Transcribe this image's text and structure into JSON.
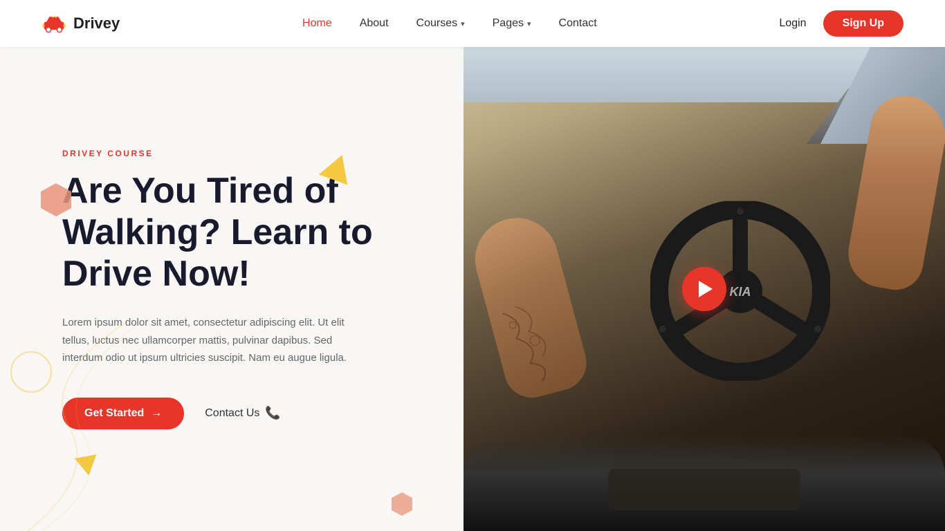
{
  "brand": {
    "logo_text": "Drivey",
    "logo_icon_label": "car-icon"
  },
  "navbar": {
    "links": [
      {
        "id": "home",
        "label": "Home",
        "active": true,
        "has_dropdown": false
      },
      {
        "id": "about",
        "label": "About",
        "active": false,
        "has_dropdown": false
      },
      {
        "id": "courses",
        "label": "Courses",
        "active": false,
        "has_dropdown": true
      },
      {
        "id": "pages",
        "label": "Pages",
        "active": false,
        "has_dropdown": true
      },
      {
        "id": "contact",
        "label": "Contact",
        "active": false,
        "has_dropdown": false
      }
    ],
    "login_label": "Login",
    "signup_label": "Sign Up"
  },
  "hero": {
    "tag": "DRIVEY COURSE",
    "title": "Are You Tired of Walking? Learn to Drive Now!",
    "description": "Lorem ipsum dolor sit amet, consectetur adipiscing elit. Ut elit tellus, luctus nec ullamcorper mattis, pulvinar dapibus. Sed interdum odio ut ipsum ultricies suscipit. Nam eu augue ligula.",
    "cta_primary": "Get Started",
    "cta_secondary": "Contact Us",
    "cta_arrow": "→",
    "cta_phone_icon": "📞",
    "play_button_label": "Play Video"
  },
  "colors": {
    "accent": "#e8352a",
    "accent_yellow": "#f5c842",
    "text_dark": "#1a1a2e",
    "text_muted": "#666666",
    "bg_light": "#f8f7f5"
  }
}
